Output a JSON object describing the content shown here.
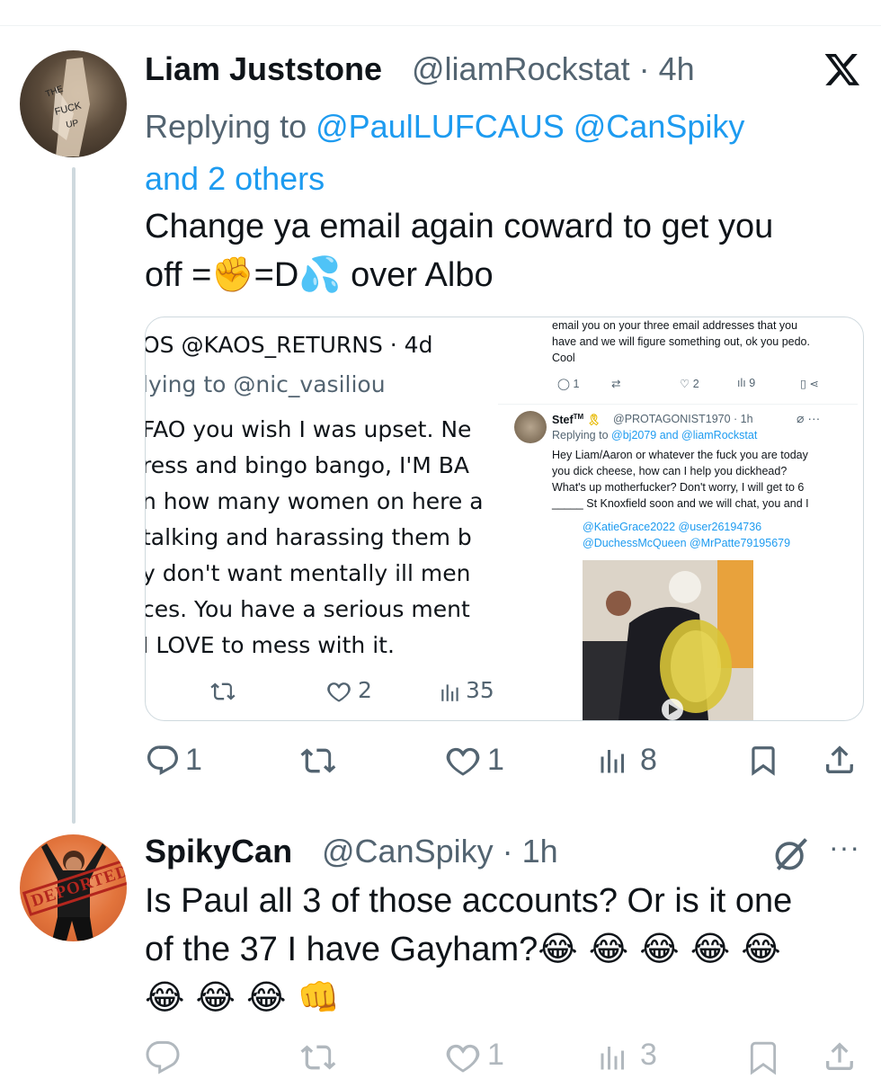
{
  "tweet1": {
    "name": "Liam Juststone",
    "handle": "@liamRockstat",
    "time": "4h",
    "replying_prefix": "Replying to",
    "mentions": "@PaulLUFCAUS @CanSpiky",
    "others": "and 2 others",
    "text_line1": "Change ya email again coward to get you",
    "text_line2_a": "off =",
    "text_line2_b": "=D",
    "text_line2_c": " over Albo",
    "metrics": {
      "replies": "1",
      "likes": "1",
      "views": "8"
    }
  },
  "quoted_screenshot_left": {
    "header": "OS @KAOS_RETURNS · 4d",
    "replying": "lying to @nic_vasiliou",
    "lines": [
      "FAO you wish I was upset. Ne",
      "ress and bingo bango, I'M BA",
      "n how many women on here a",
      "talking and harassing them b",
      "y don't want mentally ill men",
      "ces. You have a serious ment",
      " I LOVE to mess with it."
    ],
    "likes": "2",
    "views": "35"
  },
  "quoted_screenshot_right": {
    "top_lines": [
      "email you on your three email addresses that you",
      "have and we will figure something out, ok you pedo.",
      "Cool"
    ],
    "top_metrics": {
      "replies": "1",
      "likes": "2",
      "views": "9"
    },
    "name": "Stef",
    "badge": "TM",
    "handle": "@PROTAGONIST1970 · 1h",
    "replying": "Replying to",
    "replying_mentions": "@bj2079 and @liamRockstat",
    "body_lines": [
      "Hey Liam/Aaron or whatever the fuck you are today",
      "you dick cheese, how can I help you dickhead?",
      "What's up motherfucker? Don't worry, I will get to 6",
      "_____ St Knoxfield soon and we will chat, you and I"
    ],
    "tags_line1": "@KatieGrace2022 @user26194736",
    "tags_line2": "@DuchessMcQueen @MrPatte79195679"
  },
  "tweet2": {
    "name": "SpikyCan",
    "handle": "@CanSpiky",
    "time": "1h",
    "avatar_text": "DEPORTED",
    "text_line1": "Is Paul all 3 of those accounts? Or is it one",
    "text_line2": "of the 37 I have Gayham?",
    "metrics": {
      "likes": "1",
      "views": "3"
    }
  },
  "colors": {
    "accent": "#1d9bf0",
    "secondary_text": "#536471",
    "thread_line": "#cfd9de"
  },
  "icons": [
    "x-logo-icon",
    "reply-icon",
    "retweet-icon",
    "like-icon",
    "views-icon",
    "bookmark-icon",
    "share-icon",
    "grok-icon",
    "more-icon"
  ]
}
